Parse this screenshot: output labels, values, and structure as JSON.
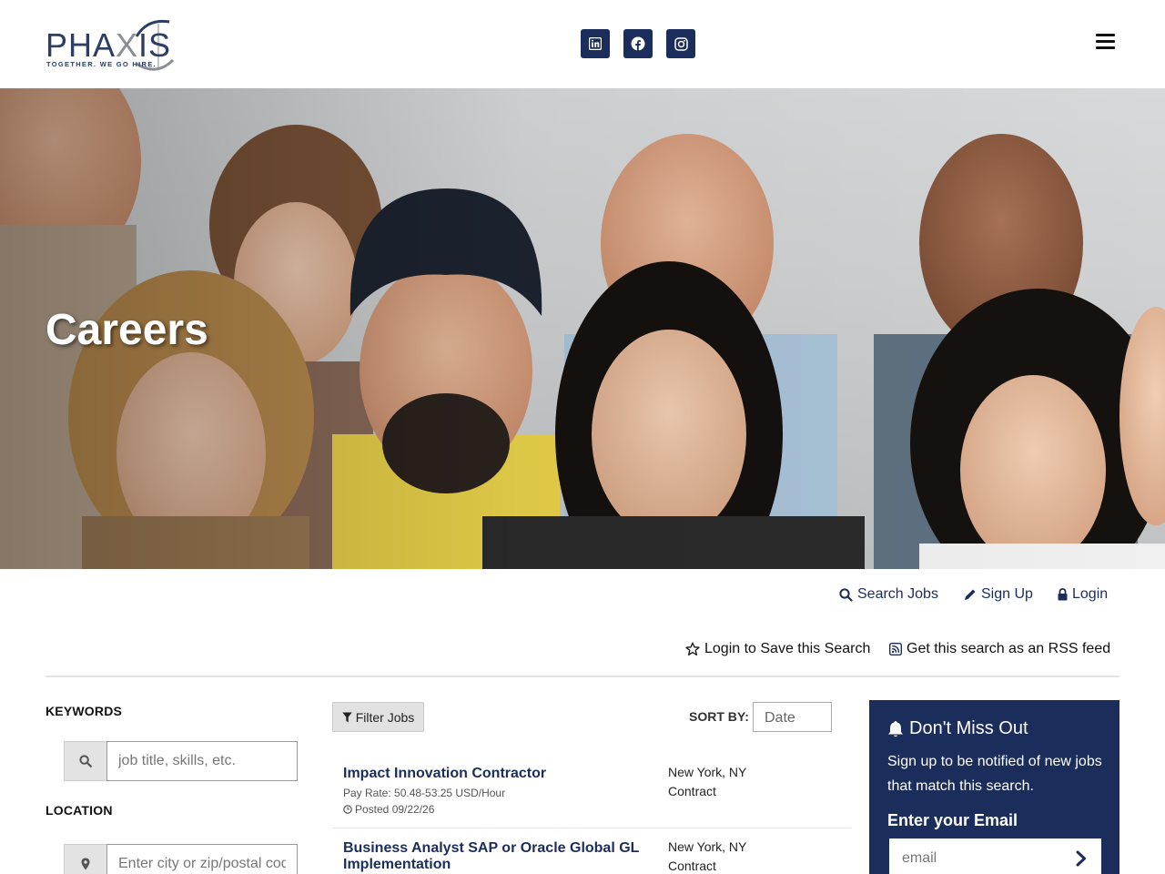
{
  "header": {
    "logo_text_left": "PH",
    "logo_text_mid": "A",
    "logo_text_x": "X",
    "logo_text_right": "IS",
    "logo_tagline": "TOGETHER. WE GO HIRE.",
    "social": [
      "linkedin-icon",
      "facebook-icon",
      "instagram-icon"
    ],
    "menu_icon": "hamburger-menu-icon"
  },
  "hero": {
    "title": "Careers"
  },
  "account": {
    "search_jobs": "Search Jobs",
    "sign_up": "Sign Up",
    "login": "Login"
  },
  "search_actions": {
    "save_search": "Login to Save this Search",
    "rss": "Get this search as an RSS feed"
  },
  "filters": {
    "keywords_label": "KEYWORDS",
    "keywords_placeholder": "job title, skills, etc.",
    "location_label": "LOCATION",
    "location_placeholder": "Enter city or zip/postal code"
  },
  "results": {
    "filter_button": "Filter Jobs",
    "sort_label": "SORT BY:",
    "sort_value": "Date",
    "jobs": [
      {
        "title": "Impact Innovation Contractor",
        "pay": "Pay Rate: 50.48-53.25 USD/Hour",
        "posted": "Posted 09/22/26",
        "location": "New York, NY",
        "type": "Contract"
      },
      {
        "title": "Business Analyst SAP or Oracle Global GL Implementation",
        "location": "New York, NY",
        "type": "Contract"
      }
    ]
  },
  "alert_panel": {
    "title": "Don't Miss Out",
    "description": "Sign up to be notified of new jobs that match this search.",
    "email_label": "Enter your Email",
    "email_placeholder": "email"
  },
  "colors": {
    "brand_navy": "#1b2d5a",
    "logo_gray": "#8a8d93"
  }
}
